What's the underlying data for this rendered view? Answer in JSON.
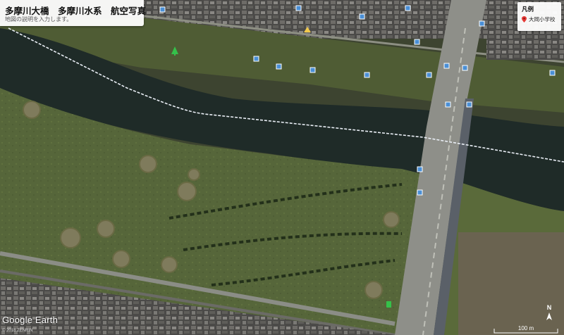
{
  "title": "多摩川大橋　多摩川水系　航空写真",
  "description": "地図の説明を入力します。",
  "legend": {
    "title": "凡例",
    "items": [
      {
        "label": "大岡小学校",
        "icon": "red-map-pin-icon",
        "color": "#e53935"
      }
    ]
  },
  "branding": {
    "logo_text": "Google Earth",
    "copyright": "© 2018 ZENRIN"
  },
  "compass": {
    "label": "N"
  },
  "scale": {
    "label": "100 m"
  },
  "colors": {
    "river": "#1f2a27",
    "field": "#5b6b3a",
    "road": "#9a9a95",
    "route_line": "#e9eef5",
    "marker_blue": "#4a8fd6",
    "marker_green": "#35c14a"
  }
}
